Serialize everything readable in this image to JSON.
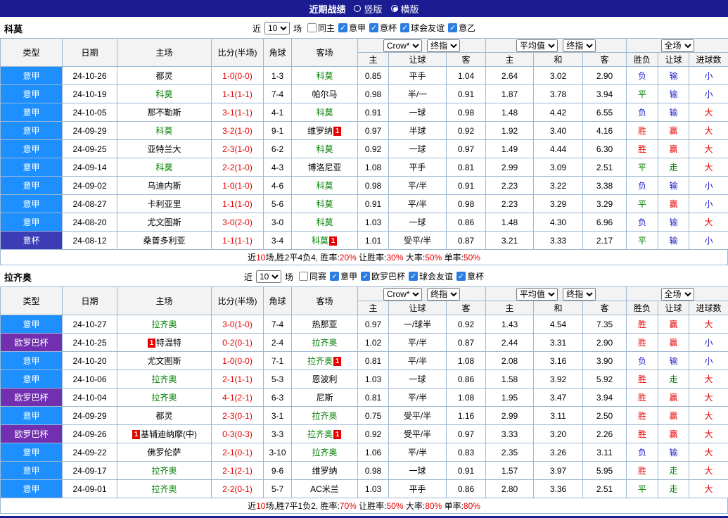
{
  "header": {
    "title": "近期战绩",
    "radios": [
      {
        "label": "竖版",
        "selected": false
      },
      {
        "label": "横版",
        "selected": true
      }
    ]
  },
  "table_head": {
    "col_type": "类型",
    "col_date": "日期",
    "col_home": "主场",
    "col_score": "比分(半场)",
    "col_corner": "角球",
    "col_away": "客场",
    "dropdowns": [
      "Crow*",
      "终指",
      "平均值",
      "终指",
      "全场"
    ],
    "sub": [
      "主",
      "让球",
      "客",
      "主",
      "和",
      "客",
      "胜负",
      "让球",
      "进球数"
    ]
  },
  "colors": {
    "league": {
      "意甲": "#1e8fff",
      "意杯": "#3c3cb4",
      "欧罗巴杯": "#7230b0"
    },
    "text": {
      "red": "#e60000",
      "blue": "#2222cc",
      "green": "#008000",
      "black": "#000000"
    }
  },
  "sections": [
    {
      "team": "科莫",
      "filter": {
        "near": "近",
        "count": "10",
        "games": "场",
        "checkboxes": [
          {
            "label": "同主",
            "checked": false
          },
          {
            "label": "意甲",
            "checked": true
          },
          {
            "label": "意杯",
            "checked": true
          },
          {
            "label": "球会友谊",
            "checked": true
          },
          {
            "label": "意乙",
            "checked": true
          }
        ]
      },
      "rows": [
        {
          "league": "意甲",
          "date": "24-10-26",
          "home": {
            "text": "都灵"
          },
          "score": "1-0(0-0)",
          "corner": "1-3",
          "away": {
            "text": "科莫",
            "green": true
          },
          "odds": [
            "0.85",
            "平手",
            "1.04"
          ],
          "avg": [
            "2.64",
            "3.02",
            "2.90"
          ],
          "result": {
            "text": "负",
            "color": "blue"
          },
          "let": {
            "text": "输",
            "color": "blue"
          },
          "goals": {
            "text": "小",
            "color": "blue"
          }
        },
        {
          "league": "意甲",
          "date": "24-10-19",
          "home": {
            "text": "科莫",
            "green": true
          },
          "score": "1-1(1-1)",
          "corner": "7-4",
          "away": {
            "text": "帕尔马"
          },
          "odds": [
            "0.98",
            "半/一",
            "0.91"
          ],
          "avg": [
            "1.87",
            "3.78",
            "3.94"
          ],
          "result": {
            "text": "平",
            "color": "green"
          },
          "let": {
            "text": "输",
            "color": "blue"
          },
          "goals": {
            "text": "小",
            "color": "blue"
          }
        },
        {
          "league": "意甲",
          "date": "24-10-05",
          "home": {
            "text": "那不勒斯"
          },
          "score": "3-1(1-1)",
          "corner": "4-1",
          "away": {
            "text": "科莫",
            "green": true
          },
          "odds": [
            "0.91",
            "一球",
            "0.98"
          ],
          "avg": [
            "1.48",
            "4.42",
            "6.55"
          ],
          "result": {
            "text": "负",
            "color": "blue"
          },
          "let": {
            "text": "输",
            "color": "blue"
          },
          "goals": {
            "text": "大",
            "color": "red"
          }
        },
        {
          "league": "意甲",
          "date": "24-09-29",
          "home": {
            "text": "科莫",
            "green": true
          },
          "score": "3-2(1-0)",
          "corner": "9-1",
          "away": {
            "text": "维罗纳",
            "badge": "1",
            "badge_pos": "after"
          },
          "odds": [
            "0.97",
            "半球",
            "0.92"
          ],
          "avg": [
            "1.92",
            "3.40",
            "4.16"
          ],
          "result": {
            "text": "胜",
            "color": "red"
          },
          "let": {
            "text": "赢",
            "color": "red"
          },
          "goals": {
            "text": "大",
            "color": "red"
          }
        },
        {
          "league": "意甲",
          "date": "24-09-25",
          "home": {
            "text": "亚特兰大"
          },
          "score": "2-3(1-0)",
          "corner": "6-2",
          "away": {
            "text": "科莫",
            "green": true
          },
          "odds": [
            "0.92",
            "一球",
            "0.97"
          ],
          "avg": [
            "1.49",
            "4.44",
            "6.30"
          ],
          "result": {
            "text": "胜",
            "color": "red"
          },
          "let": {
            "text": "赢",
            "color": "red"
          },
          "goals": {
            "text": "大",
            "color": "red"
          }
        },
        {
          "league": "意甲",
          "date": "24-09-14",
          "home": {
            "text": "科莫",
            "green": true
          },
          "score": "2-2(1-0)",
          "corner": "4-3",
          "away": {
            "text": "博洛尼亚"
          },
          "odds": [
            "1.08",
            "平手",
            "0.81"
          ],
          "avg": [
            "2.99",
            "3.09",
            "2.51"
          ],
          "result": {
            "text": "平",
            "color": "green"
          },
          "let": {
            "text": "走",
            "color": "green"
          },
          "goals": {
            "text": "大",
            "color": "red"
          }
        },
        {
          "league": "意甲",
          "date": "24-09-02",
          "home": {
            "text": "乌迪内斯"
          },
          "score": "1-0(1-0)",
          "corner": "4-6",
          "away": {
            "text": "科莫",
            "green": true
          },
          "odds": [
            "0.98",
            "平/半",
            "0.91"
          ],
          "avg": [
            "2.23",
            "3.22",
            "3.38"
          ],
          "result": {
            "text": "负",
            "color": "blue"
          },
          "let": {
            "text": "输",
            "color": "blue"
          },
          "goals": {
            "text": "小",
            "color": "blue"
          }
        },
        {
          "league": "意甲",
          "date": "24-08-27",
          "home": {
            "text": "卡利亚里"
          },
          "score": "1-1(1-0)",
          "corner": "5-6",
          "away": {
            "text": "科莫",
            "green": true
          },
          "odds": [
            "0.91",
            "平/半",
            "0.98"
          ],
          "avg": [
            "2.23",
            "3.29",
            "3.29"
          ],
          "result": {
            "text": "平",
            "color": "green"
          },
          "let": {
            "text": "赢",
            "color": "red"
          },
          "goals": {
            "text": "小",
            "color": "blue"
          }
        },
        {
          "league": "意甲",
          "date": "24-08-20",
          "home": {
            "text": "尤文图斯"
          },
          "score": "3-0(2-0)",
          "corner": "3-0",
          "away": {
            "text": "科莫",
            "green": true
          },
          "odds": [
            "1.03",
            "一球",
            "0.86"
          ],
          "avg": [
            "1.48",
            "4.30",
            "6.96"
          ],
          "result": {
            "text": "负",
            "color": "blue"
          },
          "let": {
            "text": "输",
            "color": "blue"
          },
          "goals": {
            "text": "大",
            "color": "red"
          }
        },
        {
          "league": "意杯",
          "date": "24-08-12",
          "home": {
            "text": "桑普多利亚"
          },
          "score": "1-1(1-1)",
          "corner": "3-4",
          "away": {
            "text": "科莫",
            "green": true,
            "badge": "1",
            "badge_pos": "after"
          },
          "odds": [
            "1.01",
            "受平/半",
            "0.87"
          ],
          "avg": [
            "3.21",
            "3.33",
            "2.17"
          ],
          "result": {
            "text": "平",
            "color": "green"
          },
          "let": {
            "text": "输",
            "color": "blue"
          },
          "goals": {
            "text": "小",
            "color": "blue"
          }
        }
      ],
      "summary": [
        [
          "近",
          "black"
        ],
        [
          "10",
          "red"
        ],
        [
          "场,胜2平4负4, 胜率:",
          "black"
        ],
        [
          "20%",
          "red"
        ],
        [
          " 让胜率:",
          "black"
        ],
        [
          "30%",
          "red"
        ],
        [
          " 大率:",
          "black"
        ],
        [
          "50%",
          "red"
        ],
        [
          " 单率:",
          "black"
        ],
        [
          "50%",
          "red"
        ]
      ]
    },
    {
      "team": "拉齐奥",
      "filter": {
        "near": "近",
        "count": "10",
        "games": "场",
        "checkboxes": [
          {
            "label": "同赛",
            "checked": false
          },
          {
            "label": "意甲",
            "checked": true
          },
          {
            "label": "欧罗巴杯",
            "checked": true
          },
          {
            "label": "球会友谊",
            "checked": true
          },
          {
            "label": "意杯",
            "checked": true
          }
        ]
      },
      "rows": [
        {
          "league": "意甲",
          "date": "24-10-27",
          "home": {
            "text": "拉齐奥",
            "green": true
          },
          "score": "3-0(1-0)",
          "corner": "7-4",
          "away": {
            "text": "热那亚"
          },
          "odds": [
            "0.97",
            "一/球半",
            "0.92"
          ],
          "avg": [
            "1.43",
            "4.54",
            "7.35"
          ],
          "result": {
            "text": "胜",
            "color": "red"
          },
          "let": {
            "text": "赢",
            "color": "red"
          },
          "goals": {
            "text": "大",
            "color": "red"
          }
        },
        {
          "league": "欧罗巴杯",
          "date": "24-10-25",
          "home": {
            "text": "特温特",
            "badge": "1",
            "badge_pos": "before"
          },
          "score": "0-2(0-1)",
          "corner": "2-4",
          "away": {
            "text": "拉齐奥",
            "green": true
          },
          "odds": [
            "1.02",
            "平/半",
            "0.87"
          ],
          "avg": [
            "2.44",
            "3.31",
            "2.90"
          ],
          "result": {
            "text": "胜",
            "color": "red"
          },
          "let": {
            "text": "赢",
            "color": "red"
          },
          "goals": {
            "text": "小",
            "color": "blue"
          }
        },
        {
          "league": "意甲",
          "date": "24-10-20",
          "home": {
            "text": "尤文图斯"
          },
          "score": "1-0(0-0)",
          "corner": "7-1",
          "away": {
            "text": "拉齐奥",
            "green": true,
            "badge": "1",
            "badge_pos": "after"
          },
          "odds": [
            "0.81",
            "平/半",
            "1.08"
          ],
          "avg": [
            "2.08",
            "3.16",
            "3.90"
          ],
          "result": {
            "text": "负",
            "color": "blue"
          },
          "let": {
            "text": "输",
            "color": "blue"
          },
          "goals": {
            "text": "小",
            "color": "blue"
          }
        },
        {
          "league": "意甲",
          "date": "24-10-06",
          "home": {
            "text": "拉齐奥",
            "green": true
          },
          "score": "2-1(1-1)",
          "corner": "5-3",
          "away": {
            "text": "恩波利"
          },
          "odds": [
            "1.03",
            "一球",
            "0.86"
          ],
          "avg": [
            "1.58",
            "3.92",
            "5.92"
          ],
          "result": {
            "text": "胜",
            "color": "red"
          },
          "let": {
            "text": "走",
            "color": "green"
          },
          "goals": {
            "text": "大",
            "color": "red"
          }
        },
        {
          "league": "欧罗巴杯",
          "date": "24-10-04",
          "home": {
            "text": "拉齐奥",
            "green": true
          },
          "score": "4-1(2-1)",
          "corner": "6-3",
          "away": {
            "text": "尼斯"
          },
          "odds": [
            "0.81",
            "平/半",
            "1.08"
          ],
          "avg": [
            "1.95",
            "3.47",
            "3.94"
          ],
          "result": {
            "text": "胜",
            "color": "red"
          },
          "let": {
            "text": "赢",
            "color": "red"
          },
          "goals": {
            "text": "大",
            "color": "red"
          }
        },
        {
          "league": "意甲",
          "date": "24-09-29",
          "home": {
            "text": "都灵"
          },
          "score": "2-3(0-1)",
          "corner": "3-1",
          "away": {
            "text": "拉齐奥",
            "green": true
          },
          "odds": [
            "0.75",
            "受平/半",
            "1.16"
          ],
          "avg": [
            "2.99",
            "3.11",
            "2.50"
          ],
          "result": {
            "text": "胜",
            "color": "red"
          },
          "let": {
            "text": "赢",
            "color": "red"
          },
          "goals": {
            "text": "大",
            "color": "red"
          }
        },
        {
          "league": "欧罗巴杯",
          "date": "24-09-26",
          "home": {
            "text": "基辅迪纳摩(中)",
            "badge": "1",
            "badge_pos": "before"
          },
          "score": "0-3(0-3)",
          "corner": "3-3",
          "away": {
            "text": "拉齐奥",
            "green": true,
            "badge": "1",
            "badge_pos": "after"
          },
          "odds": [
            "0.92",
            "受平/半",
            "0.97"
          ],
          "avg": [
            "3.33",
            "3.20",
            "2.26"
          ],
          "result": {
            "text": "胜",
            "color": "red"
          },
          "let": {
            "text": "赢",
            "color": "red"
          },
          "goals": {
            "text": "大",
            "color": "red"
          }
        },
        {
          "league": "意甲",
          "date": "24-09-22",
          "home": {
            "text": "佛罗伦萨"
          },
          "score": "2-1(0-1)",
          "corner": "3-10",
          "away": {
            "text": "拉齐奥",
            "green": true
          },
          "odds": [
            "1.06",
            "平/半",
            "0.83"
          ],
          "avg": [
            "2.35",
            "3.26",
            "3.11"
          ],
          "result": {
            "text": "负",
            "color": "blue"
          },
          "let": {
            "text": "输",
            "color": "blue"
          },
          "goals": {
            "text": "大",
            "color": "red"
          }
        },
        {
          "league": "意甲",
          "date": "24-09-17",
          "home": {
            "text": "拉齐奥",
            "green": true
          },
          "score": "2-1(2-1)",
          "corner": "9-6",
          "away": {
            "text": "维罗纳"
          },
          "odds": [
            "0.98",
            "一球",
            "0.91"
          ],
          "avg": [
            "1.57",
            "3.97",
            "5.95"
          ],
          "result": {
            "text": "胜",
            "color": "red"
          },
          "let": {
            "text": "走",
            "color": "green"
          },
          "goals": {
            "text": "大",
            "color": "red"
          }
        },
        {
          "league": "意甲",
          "date": "24-09-01",
          "home": {
            "text": "拉齐奥",
            "green": true
          },
          "score": "2-2(0-1)",
          "corner": "5-7",
          "away": {
            "text": "AC米兰"
          },
          "odds": [
            "1.03",
            "平手",
            "0.86"
          ],
          "avg": [
            "2.80",
            "3.36",
            "2.51"
          ],
          "result": {
            "text": "平",
            "color": "green"
          },
          "let": {
            "text": "走",
            "color": "green"
          },
          "goals": {
            "text": "大",
            "color": "red"
          }
        }
      ],
      "summary": [
        [
          "近",
          "black"
        ],
        [
          "10",
          "red"
        ],
        [
          "场,胜7平1负2, 胜率:",
          "black"
        ],
        [
          "70%",
          "red"
        ],
        [
          " 让胜率:",
          "black"
        ],
        [
          "50%",
          "red"
        ],
        [
          " 大率:",
          "black"
        ],
        [
          "80%",
          "red"
        ],
        [
          " 单率:",
          "black"
        ],
        [
          "80%",
          "red"
        ]
      ]
    }
  ]
}
